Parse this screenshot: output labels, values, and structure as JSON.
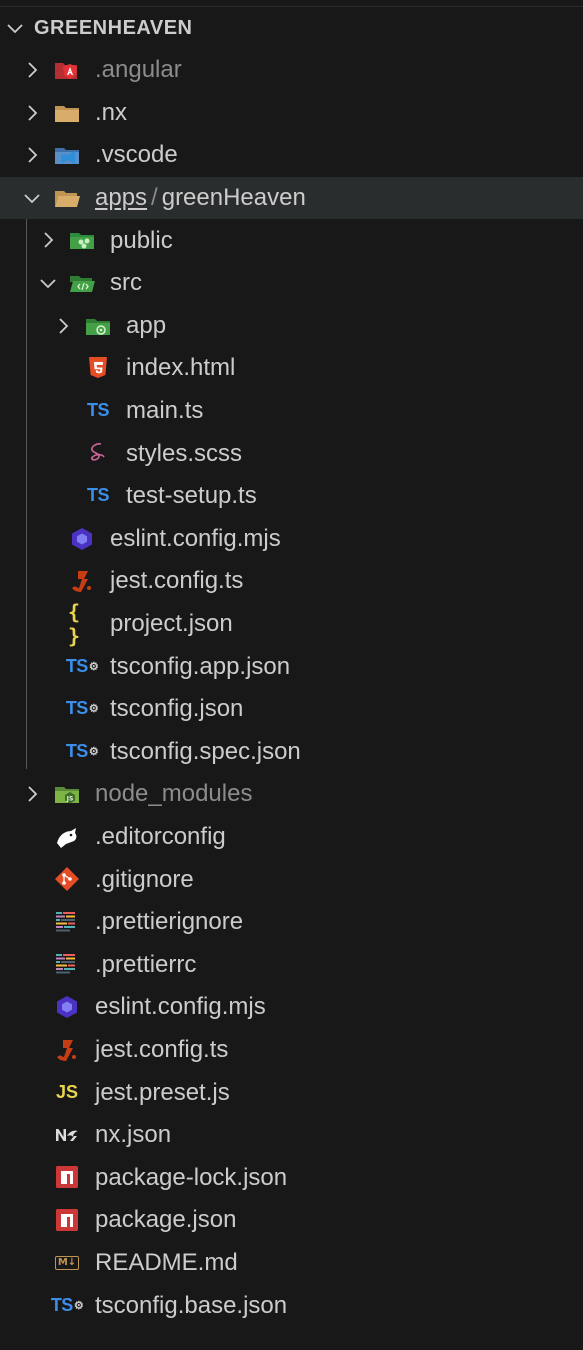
{
  "explorer": {
    "section_title": "GREENHEAVEN",
    "rows": [
      {
        "label": ".angular",
        "icon": "angular-folder-icon",
        "expandable": true,
        "dimmed": true
      },
      {
        "label": ".nx",
        "icon": "folder-icon",
        "expandable": true
      },
      {
        "label": ".vscode",
        "icon": "vscode-folder-icon",
        "expandable": true
      },
      {
        "label_a": "apps",
        "separator": "/",
        "label_b": "greenHeaven",
        "icon": "folder-open-icon",
        "expanded": true,
        "selected": true
      },
      {
        "label": "public",
        "icon": "public-folder-icon",
        "expandable": true
      },
      {
        "label": "src",
        "icon": "src-folder-open-icon",
        "expanded": true
      },
      {
        "label": "app",
        "icon": "app-folder-icon",
        "expandable": true
      },
      {
        "label": "index.html",
        "icon": "html5-icon"
      },
      {
        "label": "main.ts",
        "icon": "typescript-icon",
        "icon_text": "TS"
      },
      {
        "label": "styles.scss",
        "icon": "sass-icon"
      },
      {
        "label": "test-setup.ts",
        "icon": "typescript-icon",
        "icon_text": "TS"
      },
      {
        "label": "eslint.config.mjs",
        "icon": "eslint-icon"
      },
      {
        "label": "jest.config.ts",
        "icon": "jest-icon"
      },
      {
        "label": "project.json",
        "icon": "json-icon",
        "icon_text": "{ }"
      },
      {
        "label": "tsconfig.app.json",
        "icon": "tsconfig-icon",
        "icon_text": "TS"
      },
      {
        "label": "tsconfig.json",
        "icon": "tsconfig-icon",
        "icon_text": "TS"
      },
      {
        "label": "tsconfig.spec.json",
        "icon": "tsconfig-icon",
        "icon_text": "TS"
      },
      {
        "label": "node_modules",
        "icon": "node-folder-icon",
        "expandable": true,
        "dimmed": true
      },
      {
        "label": ".editorconfig",
        "icon": "editorconfig-icon"
      },
      {
        "label": ".gitignore",
        "icon": "git-icon"
      },
      {
        "label": ".prettierignore",
        "icon": "prettier-icon"
      },
      {
        "label": ".prettierrc",
        "icon": "prettier-icon"
      },
      {
        "label": "eslint.config.mjs",
        "icon": "eslint-icon"
      },
      {
        "label": "jest.config.ts",
        "icon": "jest-icon"
      },
      {
        "label": "jest.preset.js",
        "icon": "javascript-icon",
        "icon_text": "JS"
      },
      {
        "label": "nx.json",
        "icon": "nx-icon"
      },
      {
        "label": "package-lock.json",
        "icon": "npm-icon"
      },
      {
        "label": "package.json",
        "icon": "npm-icon"
      },
      {
        "label": "README.md",
        "icon": "markdown-icon",
        "icon_text": "M↓"
      },
      {
        "label": "tsconfig.base.json",
        "icon": "tsconfig-icon",
        "icon_text": "TS"
      }
    ]
  },
  "colors": {
    "background": "#181818",
    "text": "#cccccc",
    "dimmed_text": "#8c8c8c",
    "selected_row": "#2a2d2e",
    "typescript_blue": "#3b8eea",
    "json_yellow": "#e8d44d",
    "npm_red": "#cb3837",
    "html_orange": "#e44d26"
  }
}
